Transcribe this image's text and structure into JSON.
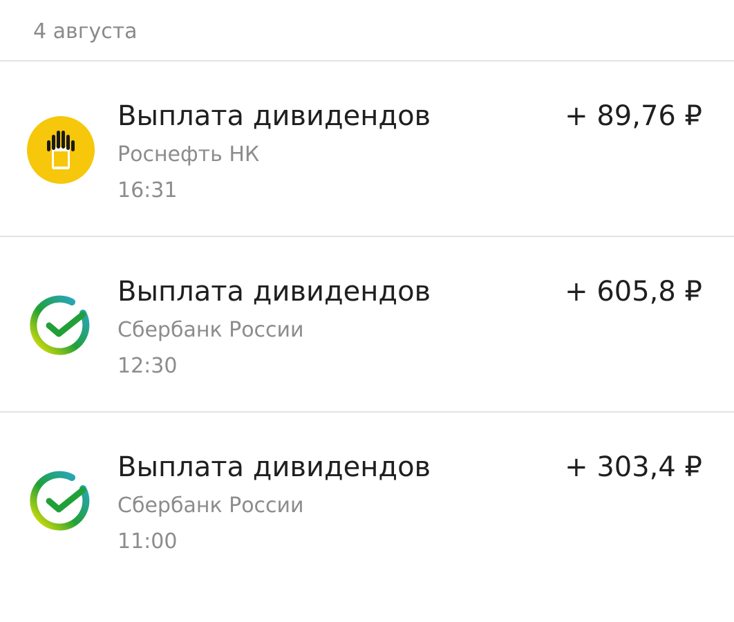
{
  "date_header": "4 августа",
  "operations": [
    {
      "title": "Выплата дивидендов",
      "company": "Роснефть НК",
      "time": "16:31",
      "amount": "+ 89,76 ₽",
      "logo": "rosneft-logo-icon"
    },
    {
      "title": "Выплата дивидендов",
      "company": "Сбербанк России",
      "time": "12:30",
      "amount": "+ 605,8 ₽",
      "logo": "sberbank-logo-icon"
    },
    {
      "title": "Выплата дивидендов",
      "company": "Сбербанк России",
      "time": "11:00",
      "amount": "+ 303,4 ₽",
      "logo": "sberbank-logo-icon"
    }
  ],
  "colors": {
    "rosneft_yellow": "#f6c70a",
    "sber_green": "#21a038",
    "sber_blue": "#2aa7e0",
    "sber_yellow": "#f2e600"
  }
}
